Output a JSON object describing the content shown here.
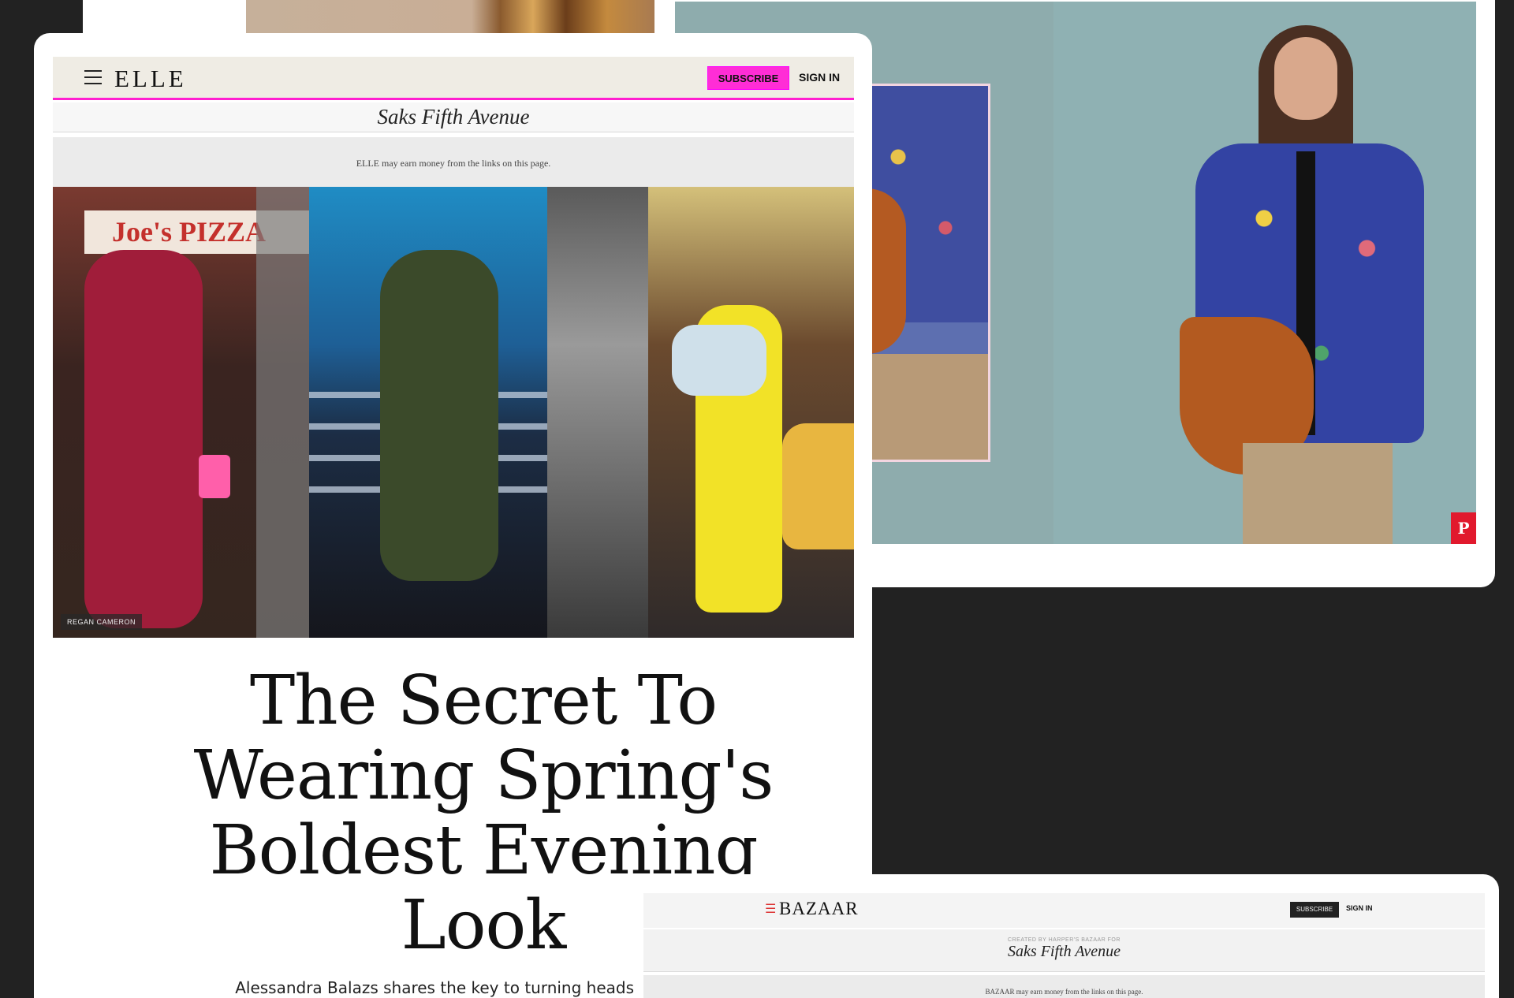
{
  "elle": {
    "logo": "ELLE",
    "subscribe_label": "SUBSCRIBE",
    "signin_label": "SIGN IN",
    "sponsor": "Saks Fifth Avenue",
    "disclaimer": "ELLE may earn money from the links on this page.",
    "hero_sign_text": "Joe's PIZZA",
    "photo_credit": "REGAN CAMERON",
    "headline": "The Secret To Wearing Spring's Boldest Evening Look",
    "dek": "Alessandra Balazs shares the key to turning heads in the"
  },
  "product": {
    "pin_label": "P"
  },
  "bazaar": {
    "logo": "BAZAAR",
    "subscribe_label": "SUBSCRIBE",
    "signin_label": "SIGN IN",
    "created_by": "CREATED BY HARPER'S BAZAAR FOR",
    "sponsor": "Saks Fifth Avenue",
    "disclaimer": "BAZAAR may earn money from the links on this page."
  },
  "colors": {
    "background": "#222222",
    "elle_accent": "#ff2dd6",
    "pinterest": "#e1192d"
  }
}
